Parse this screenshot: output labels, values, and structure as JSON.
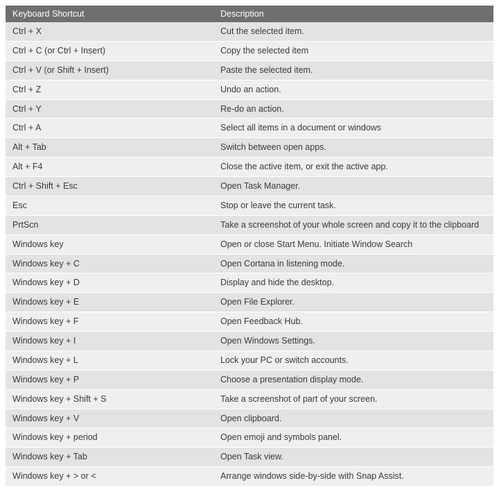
{
  "table": {
    "headers": {
      "shortcut": "Keyboard Shortcut",
      "description": "Description"
    },
    "rows": [
      {
        "shortcut": "Ctrl + X",
        "description": "Cut the selected item."
      },
      {
        "shortcut": "Ctrl + C (or Ctrl + Insert)",
        "description": "Copy the selected item"
      },
      {
        "shortcut": "Ctrl + V (or Shift + Insert)",
        "description": "Paste the selected item."
      },
      {
        "shortcut": "Ctrl + Z",
        "description": "Undo an action."
      },
      {
        "shortcut": "Ctrl + Y",
        "description": "Re-do an action."
      },
      {
        "shortcut": "Ctrl + A",
        "description": "Select all items in a document or windows"
      },
      {
        "shortcut": "Alt + Tab",
        "description": "Switch between open apps."
      },
      {
        "shortcut": "Alt + F4",
        "description": "Close the active item, or exit the active app."
      },
      {
        "shortcut": "Ctrl + Shift + Esc",
        "description": "Open Task Manager."
      },
      {
        "shortcut": "Esc",
        "description": "Stop or leave the current task."
      },
      {
        "shortcut": "PrtScn",
        "description": "Take a screenshot of your whole screen and copy it to the clipboard"
      },
      {
        "shortcut": "Windows key",
        "description": "Open or close Start Menu. Initiate Window Search"
      },
      {
        "shortcut": "Windows key + C",
        "description": "Open Cortana in listening mode."
      },
      {
        "shortcut": "Windows key + D",
        "description": "Display and hide the desktop."
      },
      {
        "shortcut": "Windows key + E",
        "description": "Open File Explorer."
      },
      {
        "shortcut": "Windows key + F",
        "description": "Open Feedback Hub."
      },
      {
        "shortcut": "Windows key + I",
        "description": "Open Windows Settings."
      },
      {
        "shortcut": "Windows key + L",
        "description": "Lock your PC or switch accounts."
      },
      {
        "shortcut": "Windows key + P",
        "description": "Choose a presentation display mode."
      },
      {
        "shortcut": "Windows key + Shift + S",
        "description": "Take a screenshot of part of your screen."
      },
      {
        "shortcut": "Windows key + V",
        "description": "Open clipboard."
      },
      {
        "shortcut": "Windows key + period",
        "description": "Open emoji and symbols panel."
      },
      {
        "shortcut": "Windows key + Tab",
        "description": "Open Task view."
      },
      {
        "shortcut": "Windows key + > or <",
        "description": "Arrange windows side-by-side with Snap Assist."
      }
    ]
  }
}
